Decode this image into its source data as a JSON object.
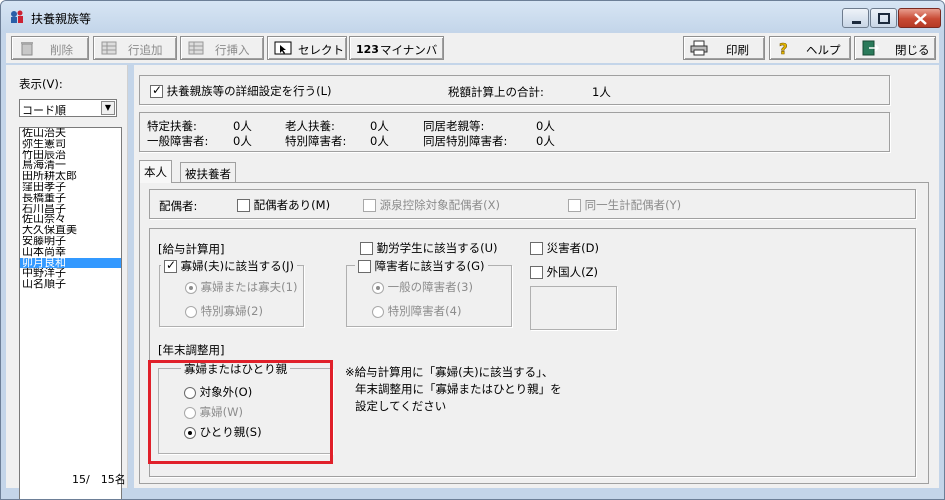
{
  "window": {
    "title": "扶養親族等"
  },
  "toolbar": {
    "delete": "削除",
    "add_row": "行追加",
    "insert_row": "行挿入",
    "select": "セレクト",
    "my_number": "マイナンバー",
    "print": "印刷",
    "help": "ヘルプ",
    "close": "閉じる"
  },
  "left": {
    "display_label": "表示(V):",
    "sort_value": "コード順",
    "names": [
      "佐山治夫",
      "弥生憲司",
      "竹田辰治",
      "鳥海清一",
      "田所耕太郎",
      "窪田孝子",
      "長橋董子",
      "石川昌子",
      "佐山奈々",
      "大久保直美",
      "安藤明子",
      "山本尚幸",
      "卯月良和",
      "中野洋子",
      "山名順子"
    ],
    "selected_index": 12,
    "count": "15/　15名"
  },
  "settings": {
    "detail_label": "扶養親族等の詳細設定を行う(L)",
    "detail_checked": true,
    "tax_total_label": "税額計算上の合計:",
    "tax_total_value": "1人"
  },
  "summary": {
    "r1c1_label": "特定扶養:",
    "r1c1_value": "0人",
    "r1c2_label": "老人扶養:",
    "r1c2_value": "0人",
    "r1c3_label": "同居老親等:",
    "r1c3_value": "0人",
    "r2c1_label": "一般障害者:",
    "r2c1_value": "0人",
    "r2c2_label": "特別障害者:",
    "r2c2_value": "0人",
    "r2c3_label": "同居特別障害者:",
    "r2c3_value": "0人"
  },
  "tabs": {
    "self": "本人",
    "dependent": "被扶養者"
  },
  "spouse": {
    "label": "配偶者:",
    "has_spouse": "配偶者あり(M)",
    "withholding": "源泉控除対象配偶者(X)",
    "same_household": "同一生計配偶者(Y)"
  },
  "salary": {
    "section_label": "[給与計算用]",
    "widow_check": "寡婦(夫)に該当する(J)",
    "widow_checked": true,
    "widow_opt1": "寡婦または寡夫(1)",
    "widow_opt2": "特別寡婦(2)",
    "working_student": "勤労学生に該当する(U)",
    "disabled_check": "障害者に該当する(G)",
    "disabled_opt1": "一般の障害者(3)",
    "disabled_opt2": "特別障害者(4)",
    "disaster": "災害者(D)",
    "foreigner": "外国人(Z)"
  },
  "yearend": {
    "section_label": "[年末調整用]",
    "group_title": "寡婦またはひとり親",
    "opt_none": "対象外(O)",
    "opt_widow": "寡婦(W)",
    "opt_single": "ひとり親(S)",
    "selected": "ひとり親(S)",
    "note_line1": "※給与計算用に「寡婦(夫)に該当する」、",
    "note_line2": "年末調整用に「寡婦またはひとり親」を",
    "note_line3": "設定してください"
  },
  "colors": {
    "highlight": "#e0202a",
    "selection": "#3399ff"
  }
}
